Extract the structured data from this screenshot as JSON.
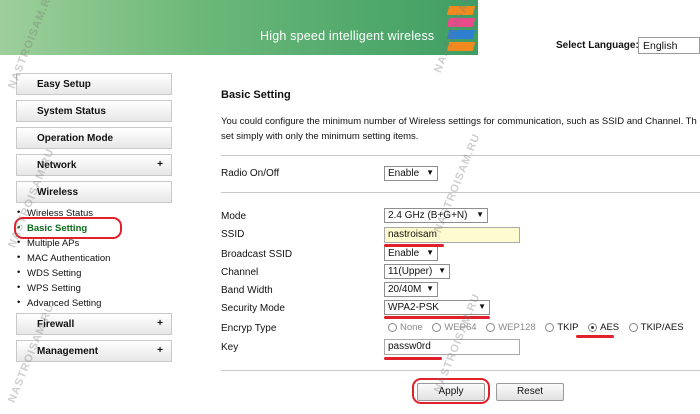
{
  "header": {
    "title": "High speed intelligent wireless",
    "language_label": "Select Language:",
    "language_value": "English",
    "stripe_colors": [
      "#f08a1e",
      "#e94b8a",
      "#2f7fd1",
      "#f08a1e"
    ]
  },
  "sidebar": {
    "easy_setup": "Easy Setup",
    "system_status": "System Status",
    "operation_mode": "Operation Mode",
    "network": "Network",
    "wireless": "Wireless",
    "plus": "+",
    "wireless_items": [
      "Wireless Status",
      "Basic Setting",
      "Multiple APs",
      "MAC Authentication",
      "WDS Setting",
      "WPS Setting",
      "Advanced Setting"
    ],
    "firewall": "Firewall",
    "management": "Management"
  },
  "main": {
    "title": "Basic Setting",
    "desc_line1": "You could configure the minimum number of Wireless settings for communication, such as SSID and Channel. Th",
    "desc_line2": "set simply with only the minimum setting items.",
    "radio_label": "Radio On/Off",
    "radio_value": "Enable",
    "mode_label": "Mode",
    "mode_value": "2.4 GHz (B+G+N)",
    "ssid_label": "SSID",
    "ssid_value": "nastroisam",
    "broadcast_label": "Broadcast SSID",
    "broadcast_value": "Enable",
    "channel_label": "Channel",
    "channel_value": "11(Upper)",
    "bandwidth_label": "Band Width",
    "bandwidth_value": "20/40M",
    "security_label": "Security Mode",
    "security_value": "WPA2-PSK",
    "encryp_label": "Encryp Type",
    "encryp_options": [
      "None",
      "WEP64",
      "WEP128",
      "TKIP",
      "AES",
      "TKIP/AES"
    ],
    "key_label": "Key",
    "key_value": "passw0rd",
    "apply": "Apply",
    "reset": "Reset"
  },
  "watermark": "NASTROISAM.RU",
  "accent": "#e0202a"
}
